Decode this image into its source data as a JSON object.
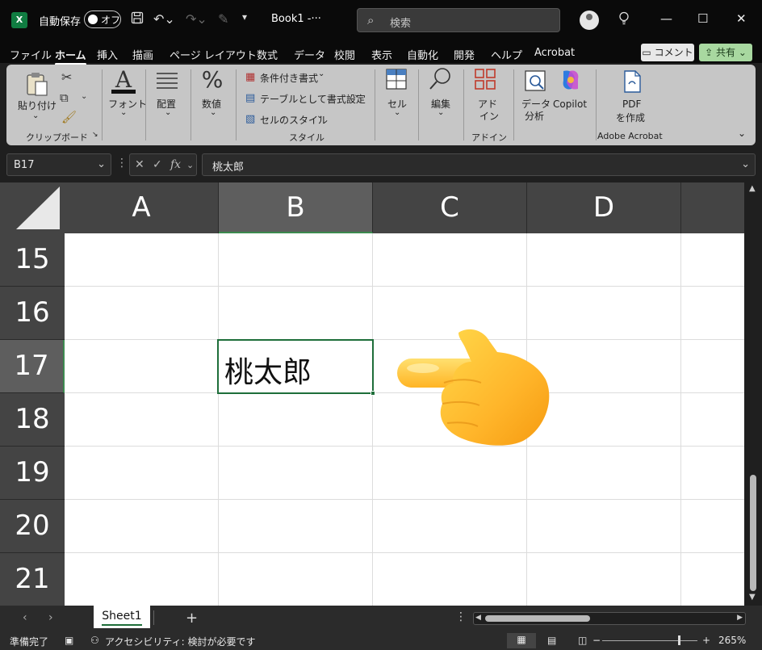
{
  "titlebar": {
    "autosave_label": "自動保存",
    "autosave_state": "オフ",
    "book_title": "Book1  -···",
    "search_placeholder": "検索"
  },
  "menu": {
    "items": [
      "ファイル",
      "ホーム",
      "挿入",
      "描画",
      "ページ レイアウト",
      "数式",
      "データ",
      "校閲",
      "表示",
      "自動化",
      "開発",
      "ヘルプ",
      "Acrobat"
    ],
    "active": "ホーム",
    "comment_label": "コメント",
    "share_label": "共有"
  },
  "ribbon": {
    "clipboard": {
      "paste": "貼り付け",
      "group": "クリップボード"
    },
    "font": "フォント",
    "alignment": "配置",
    "number": "数値",
    "styles": {
      "conditional": "条件付き書式",
      "table": "テーブルとして書式設定",
      "cell_styles": "セルのスタイル",
      "group": "スタイル"
    },
    "cells": "セル",
    "editing": "編集",
    "addins": {
      "line1": "アド",
      "line2": "イン",
      "group": "アドイン"
    },
    "analyze": {
      "line1": "データ",
      "line2": "分析"
    },
    "copilot": "Copilot",
    "pdf": {
      "line1": "PDF",
      "line2": "を作成",
      "group": "Adobe Acrobat"
    }
  },
  "formula_bar": {
    "name_box": "B17",
    "fx": "fx",
    "value": "桃太郎"
  },
  "grid": {
    "columns": [
      "A",
      "B",
      "C",
      "D"
    ],
    "selected_column": "B",
    "rows": [
      "15",
      "16",
      "17",
      "18",
      "19",
      "20",
      "21"
    ],
    "selected_row": "17",
    "active_cell_text": "桃太郎"
  },
  "sheets": {
    "tabs": [
      "Sheet1"
    ],
    "active": "Sheet1"
  },
  "status": {
    "ready": "準備完了",
    "accessibility": "アクセシビリティ: 検討が必要です",
    "zoom": "265%"
  },
  "colors": {
    "accent_green": "#1e6e3a",
    "ribbon_bg": "#c6c6c6",
    "header_bg": "#444444"
  },
  "icons": [
    "excel-logo-icon",
    "save-icon",
    "undo-icon",
    "redo-icon",
    "search-icon",
    "lightbulb-icon",
    "pointing-hand-emoji"
  ]
}
